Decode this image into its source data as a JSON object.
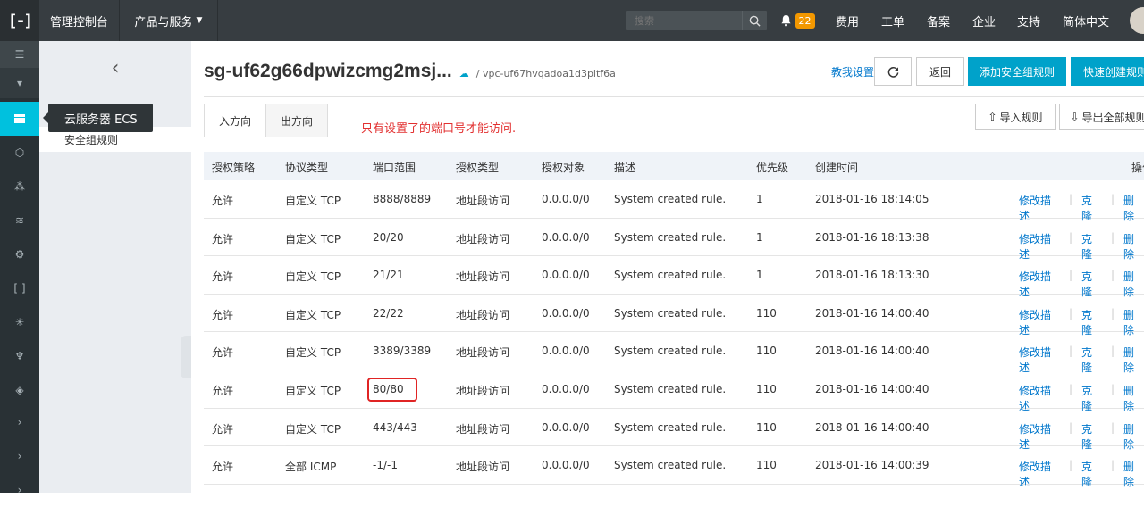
{
  "topbar": {
    "logo": "[-]",
    "console": "管理控制台",
    "products": "产品与服务",
    "search_placeholder": "搜索",
    "notif_count": "22",
    "links": [
      "费用",
      "工单",
      "备案",
      "企业",
      "支持",
      "简体中文"
    ]
  },
  "tooltip": "云服务器 ECS",
  "subnav": {
    "items": [
      "安全组规则"
    ]
  },
  "header": {
    "title": "sg-uf62g66dpwizcmg2msj...",
    "vpc": "/ vpc-uf67hvqadoa1d3pltf6a",
    "help_link": "教我设置",
    "back_label": "返回",
    "add_rule_label": "添加安全组规则",
    "quick_create_label": "快速创建规则"
  },
  "tabs": [
    "入方向",
    "出方向"
  ],
  "notice": "只有设置了的端口号才能访问.",
  "actions": {
    "import": "导入规则",
    "export": "导出全部规则"
  },
  "table": {
    "columns": [
      "授权策略",
      "协议类型",
      "端口范围",
      "授权类型",
      "授权对象",
      "描述",
      "优先级",
      "创建时间",
      "操作"
    ],
    "rows": [
      {
        "policy": "允许",
        "protocol": "自定义 TCP",
        "port": "8888/8889",
        "auth_type": "地址段访问",
        "target": "0.0.0.0/0",
        "desc": "System created rule.",
        "priority": "1",
        "created": "2018-01-16 18:14:05"
      },
      {
        "policy": "允许",
        "protocol": "自定义 TCP",
        "port": "20/20",
        "auth_type": "地址段访问",
        "target": "0.0.0.0/0",
        "desc": "System created rule.",
        "priority": "1",
        "created": "2018-01-16 18:13:38"
      },
      {
        "policy": "允许",
        "protocol": "自定义 TCP",
        "port": "21/21",
        "auth_type": "地址段访问",
        "target": "0.0.0.0/0",
        "desc": "System created rule.",
        "priority": "1",
        "created": "2018-01-16 18:13:30"
      },
      {
        "policy": "允许",
        "protocol": "自定义 TCP",
        "port": "22/22",
        "auth_type": "地址段访问",
        "target": "0.0.0.0/0",
        "desc": "System created rule.",
        "priority": "110",
        "created": "2018-01-16 14:00:40"
      },
      {
        "policy": "允许",
        "protocol": "自定义 TCP",
        "port": "3389/3389",
        "auth_type": "地址段访问",
        "target": "0.0.0.0/0",
        "desc": "System created rule.",
        "priority": "110",
        "created": "2018-01-16 14:00:40"
      },
      {
        "policy": "允许",
        "protocol": "自定义 TCP",
        "port": "80/80",
        "auth_type": "地址段访问",
        "target": "0.0.0.0/0",
        "desc": "System created rule.",
        "priority": "110",
        "created": "2018-01-16 14:00:40"
      },
      {
        "policy": "允许",
        "protocol": "自定义 TCP",
        "port": "443/443",
        "auth_type": "地址段访问",
        "target": "0.0.0.0/0",
        "desc": "System created rule.",
        "priority": "110",
        "created": "2018-01-16 14:00:40"
      },
      {
        "policy": "允许",
        "protocol": "全部 ICMP",
        "port": "-1/-1",
        "auth_type": "地址段访问",
        "target": "0.0.0.0/0",
        "desc": "System created rule.",
        "priority": "110",
        "created": "2018-01-16 14:00:39"
      }
    ],
    "op_labels": {
      "edit": "修改描述",
      "clone": "克隆",
      "delete": "删除"
    }
  },
  "colors": {
    "accent": "#00c1de",
    "primary_button": "#00a2ca",
    "topbar": "#373d41",
    "link": "#0077cc",
    "notice": "#e23030"
  }
}
